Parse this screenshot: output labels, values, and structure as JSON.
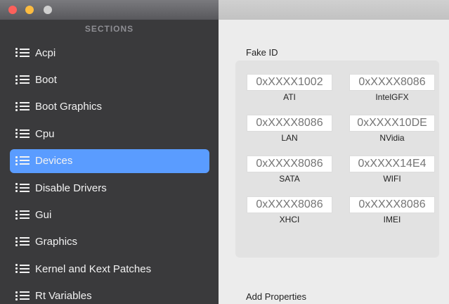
{
  "window": {
    "traffic_lights": [
      "close",
      "minimize",
      "zoom"
    ]
  },
  "sidebar": {
    "header": "SECTIONS",
    "items": [
      {
        "label": "Acpi",
        "icon": "list-icon",
        "selected": false
      },
      {
        "label": "Boot",
        "icon": "list-icon",
        "selected": false
      },
      {
        "label": "Boot Graphics",
        "icon": "list-icon",
        "selected": false
      },
      {
        "label": "Cpu",
        "icon": "list-icon",
        "selected": false
      },
      {
        "label": "Devices",
        "icon": "list-icon",
        "selected": true
      },
      {
        "label": "Disable Drivers",
        "icon": "list-icon",
        "selected": false
      },
      {
        "label": "Gui",
        "icon": "list-icon",
        "selected": false
      },
      {
        "label": "Graphics",
        "icon": "list-icon",
        "selected": false
      },
      {
        "label": "Kernel and Kext Patches",
        "icon": "list-icon",
        "selected": false
      },
      {
        "label": "Rt Variables",
        "icon": "list-icon",
        "selected": false
      }
    ],
    "selection_color": "#5a9cff"
  },
  "main": {
    "fake_id": {
      "title": "Fake ID",
      "fields": [
        {
          "label": "ATI",
          "placeholder": "0xXXXX1002"
        },
        {
          "label": "IntelGFX",
          "placeholder": "0xXXXX8086"
        },
        {
          "label": "LAN",
          "placeholder": "0xXXXX8086"
        },
        {
          "label": "NVidia",
          "placeholder": "0xXXXX10DE"
        },
        {
          "label": "SATA",
          "placeholder": "0xXXXX8086"
        },
        {
          "label": "WIFI",
          "placeholder": "0xXXXX14E4"
        },
        {
          "label": "XHCI",
          "placeholder": "0xXXXX8086"
        },
        {
          "label": "IMEI",
          "placeholder": "0xXXXX8086"
        }
      ]
    },
    "add_properties": {
      "title": "Add Properties"
    }
  }
}
